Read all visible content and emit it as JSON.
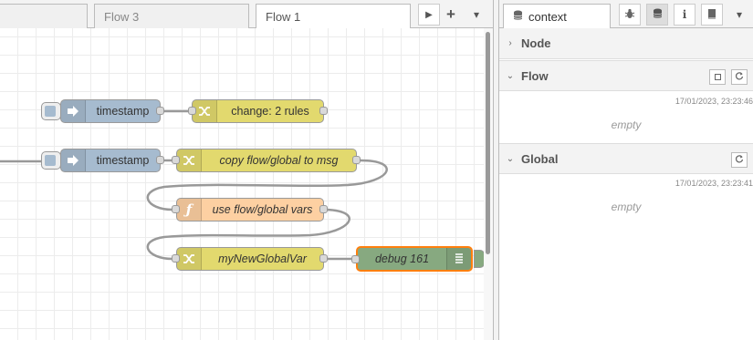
{
  "workspace": {
    "tabs": [
      {
        "label": ""
      },
      {
        "label": "Flow 3"
      },
      {
        "label": "Flow 1"
      }
    ],
    "controls": {
      "scroll_right": "▶",
      "add": "+",
      "menu": "▾"
    },
    "nodes": {
      "inject_1": {
        "label": "timestamp",
        "icon": "arrow-right-icon"
      },
      "change_1": {
        "label": "change: 2 rules",
        "icon": "shuffle-icon"
      },
      "inject_2": {
        "label": "timestamp",
        "icon": "arrow-right-icon"
      },
      "change_2": {
        "label": "copy flow/global to msg",
        "icon": "shuffle-icon"
      },
      "function_1": {
        "label": "use flow/global vars",
        "icon": "function-icon",
        "icon_glyph": "ƒ"
      },
      "change_3": {
        "label": "myNewGlobalVar",
        "icon": "shuffle-icon"
      },
      "debug_1": {
        "label": "debug 161",
        "icon": "list-icon"
      }
    }
  },
  "sidebar": {
    "active_tab": "context",
    "tab_icons": [
      "bug-icon",
      "database-icon",
      "info-icon",
      "book-icon",
      "chevron-down-icon"
    ],
    "info_glyph": "i",
    "menu_glyph": "▾",
    "node_section": {
      "title": "Node",
      "chevron": "›"
    },
    "flow_section": {
      "title": "Flow",
      "chevron": "⌄",
      "timestamp": "17/01/2023, 23:23:46",
      "empty_text": "empty"
    },
    "global_section": {
      "title": "Global",
      "chevron": "⌄",
      "timestamp": "17/01/2023, 23:23:41",
      "empty_text": "empty"
    }
  },
  "colors": {
    "inject": "#a6bbcf",
    "change": "#e2d96e",
    "function": "#fdd0a2",
    "debug": "#87a980",
    "selected_outline": "#ff7f0e"
  }
}
